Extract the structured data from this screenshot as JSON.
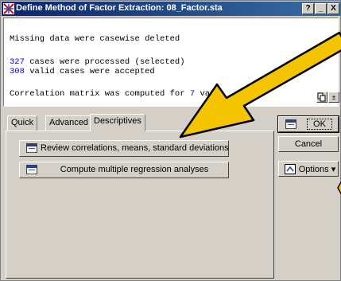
{
  "window": {
    "title": "Define Method of Factor Extraction: 08_Factor.sta",
    "help_label": "?",
    "minimize_label": "_",
    "close_label": "X"
  },
  "log": {
    "line1": "Missing data were casewise deleted",
    "line2_num": "327",
    "line2_text": " cases were processed (selected)",
    "line3_num": "308",
    "line3_text": " valid cases were accepted",
    "line4_text": "Correlation matrix was computed for ",
    "line4_num": "7",
    "line4_rest": " vari",
    "scroll_up_label": "±"
  },
  "tabs": [
    {
      "label": "Quick"
    },
    {
      "label": "Advanced"
    },
    {
      "label": "Descriptives"
    }
  ],
  "panel": {
    "review_label": "Review correlations, means, standard deviations",
    "regression_label": "Compute multiple regression analyses"
  },
  "side": {
    "ok_label": "OK",
    "cancel_label": "Cancel",
    "options_label": "Options ▾"
  },
  "colors": {
    "arrow_fill": "#f5c400",
    "title_start": "#0a246a",
    "title_end": "#3a6ea5",
    "log_number": "#0000ee"
  }
}
